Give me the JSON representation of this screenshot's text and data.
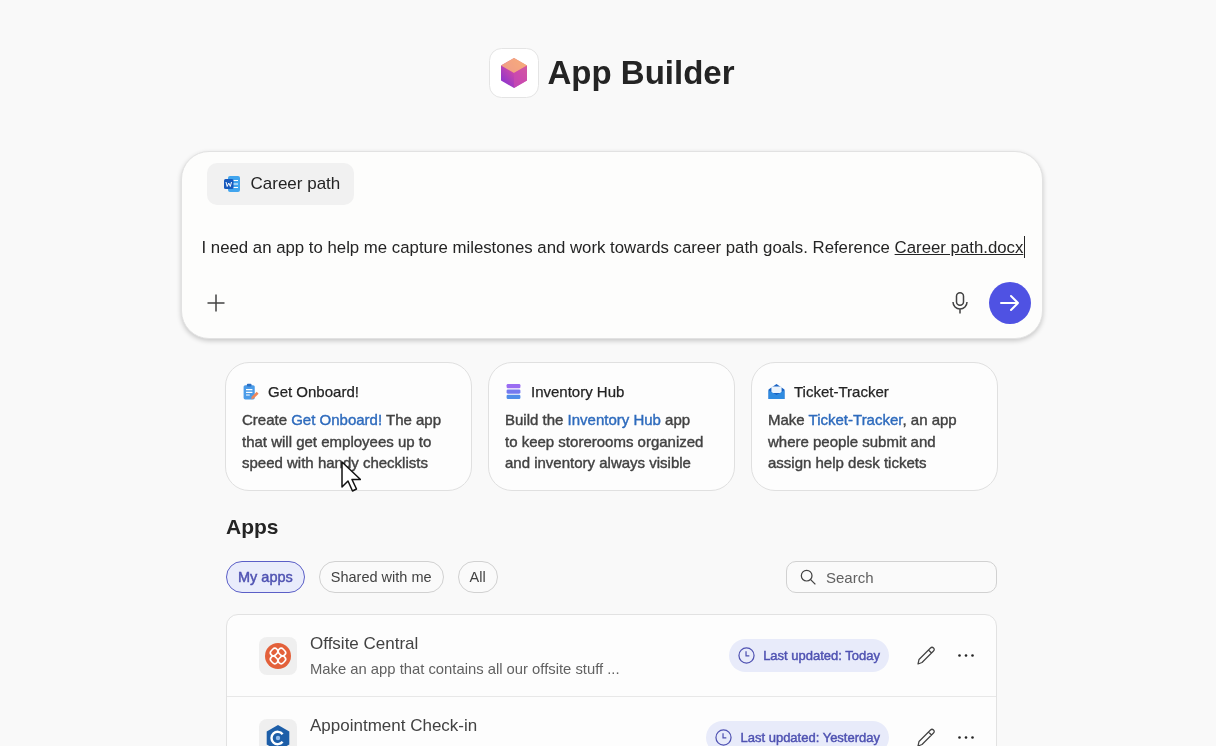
{
  "header": {
    "title": "App Builder"
  },
  "prompt": {
    "attachment": "Career path",
    "text": "I need an app to help me capture milestones and work towards career path goals. Reference",
    "reference": "Career path.docx"
  },
  "suggestions": [
    {
      "kind": "clipboard",
      "title": "Get Onboard!",
      "before": "Create ",
      "highlight": "Get Onboard!",
      "after": " The app that will get employees up to speed with handy checklists"
    },
    {
      "kind": "stack",
      "title": "Inventory Hub",
      "before": "Build the ",
      "highlight": "Inventory Hub",
      "after": " app to keep storerooms organized and inventory always visible"
    },
    {
      "kind": "envelope",
      "title": "Ticket-Tracker",
      "before": "Make ",
      "highlight": "Ticket-Tracker",
      "after": ", an app where people submit and assign help desk tickets"
    }
  ],
  "apps": {
    "heading": "Apps",
    "filters": [
      {
        "label": "My apps",
        "selected": true
      },
      {
        "label": "Shared with me",
        "selected": false
      },
      {
        "label": "All",
        "selected": false
      }
    ],
    "search": {
      "placeholder": "Search"
    },
    "list": [
      {
        "kind": "knot",
        "name": "Offsite Central",
        "description": "Make an app that contains all our offsite stuff ...",
        "updated": "Last updated: Today"
      },
      {
        "kind": "hexagon",
        "name": "Appointment Check-in",
        "updated": "Last updated: Yesterday"
      }
    ]
  }
}
